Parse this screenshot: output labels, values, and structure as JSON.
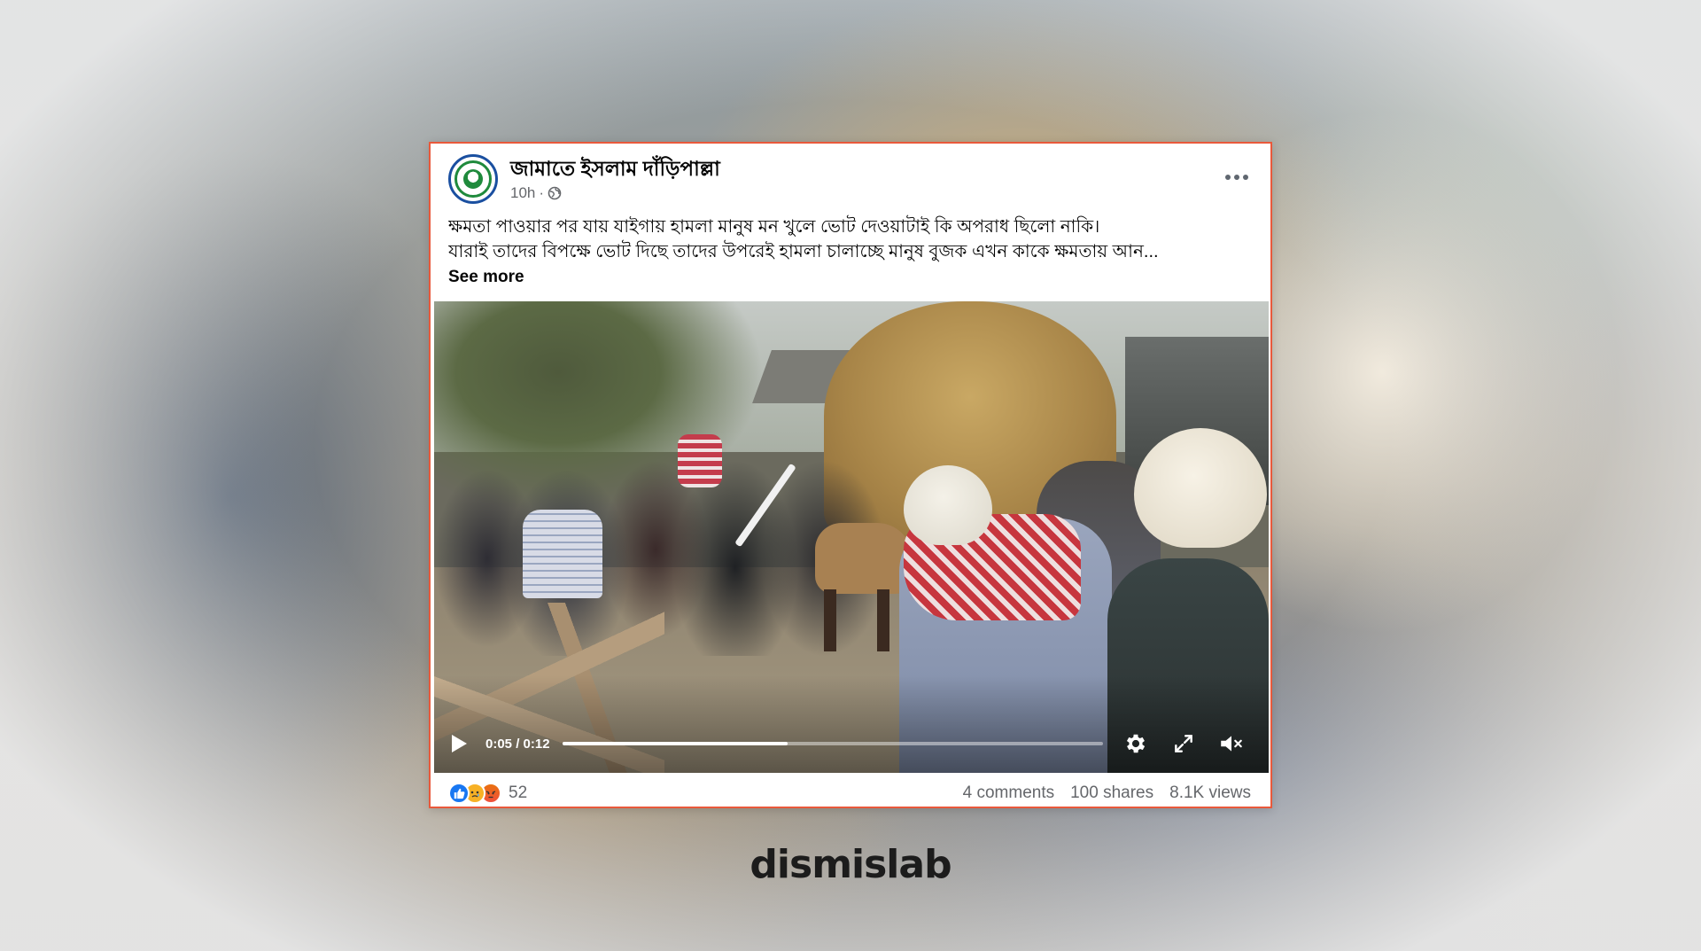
{
  "post": {
    "page_name": "জামাতে ইসলাম দাঁড়িপাল্লা",
    "time_ago": "10h",
    "meta_separator": "·",
    "privacy_icon": "globe-icon",
    "more_icon": "more-options-icon",
    "text_line1": "ক্ষমতা পাওয়ার পর যায় যাইগায় হামলা মানুষ মন খুলে ভোট দেওয়াটাই কি অপরাধ ছিলো নাকি।",
    "text_line2": "যারাই তাদের বিপক্ষে ভোট দিছে তাদের উপরেই হামলা চালাচ্ছে মানুষ বুজক এখন কাকে ক্ষমতায় আন...",
    "see_more": "See more"
  },
  "video": {
    "time_display": "0:05 / 0:12",
    "progress": 0.4167,
    "play_icon": "play-icon",
    "settings_icon": "gear-icon",
    "fullscreen_icon": "fullscreen-icon",
    "mute_icon": "muted-speaker-icon"
  },
  "footer": {
    "reactions": [
      "like",
      "sad",
      "angry"
    ],
    "reaction_count": "52",
    "comments": "4 comments",
    "shares": "100 shares",
    "views": "8.1K views"
  },
  "brand": {
    "logo_text": "dismislab"
  },
  "colors": {
    "border_accent": "#e9593b",
    "like_blue": "#1877f2",
    "sad_yellow": "#f7b125",
    "angry_orange": "#e9710f",
    "muted_text": "#65676b"
  }
}
